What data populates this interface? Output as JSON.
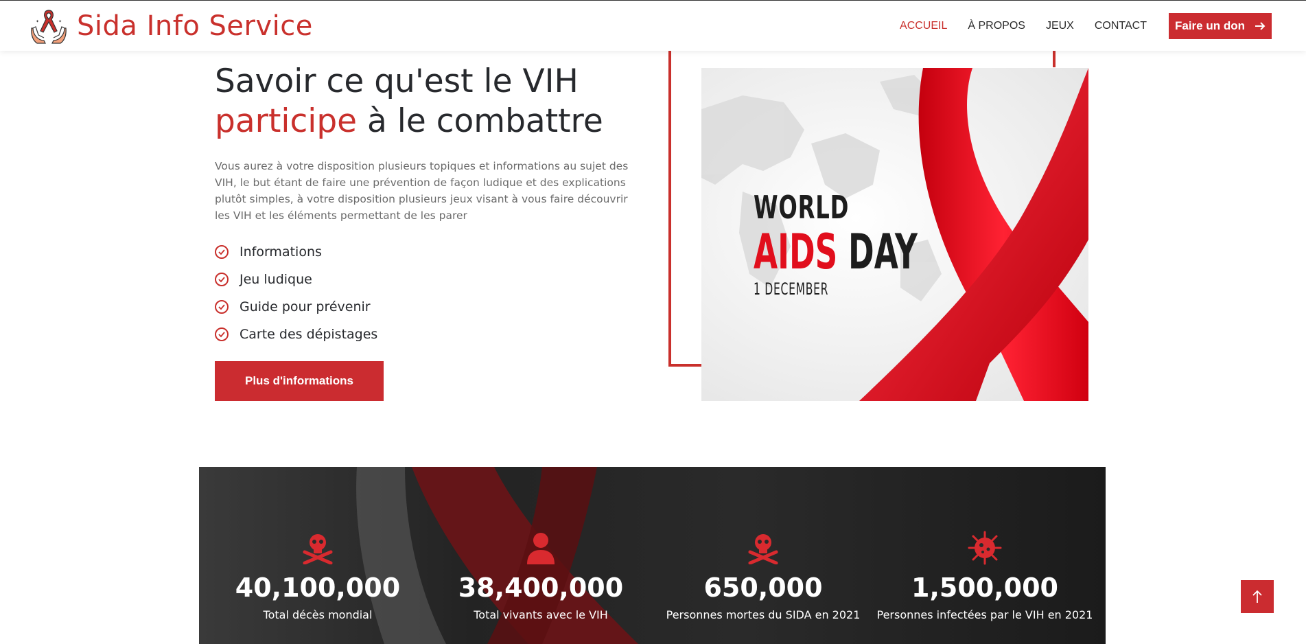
{
  "header": {
    "brand": "Sida Info Service",
    "nav": [
      {
        "label": "ACCUEIL",
        "active": true
      },
      {
        "label": "À PROPOS",
        "active": false
      },
      {
        "label": "JEUX",
        "active": false
      },
      {
        "label": "CONTACT",
        "active": false
      }
    ],
    "donate_label": "Faire un don"
  },
  "hero": {
    "title_line1": "Savoir ce qu'est le VIH",
    "title_accent": "participe",
    "title_rest": " à le combattre",
    "description": "Vous aurez à votre disposition plusieurs topiques et informations au sujet des VIH, le but étant de faire une prévention de façon ludique et des explications plutôt simples, à votre disposition plusieurs jeux visant à vous faire découvrir les VIH et les éléments permettant de les parer",
    "features": [
      "Informations",
      "Jeu ludique",
      "Guide pour prévenir",
      "Carte des dépistages"
    ],
    "button_label": "Plus d'informations"
  },
  "image": {
    "world": "WORLD",
    "aids": "AIDS",
    "day": "DAY",
    "date": "1 DECEMBER"
  },
  "stats": [
    {
      "icon": "skull-crossbones-icon",
      "value": "40,100,000",
      "label": "Total décès mondial"
    },
    {
      "icon": "person-icon",
      "value": "38,400,000",
      "label": "Total vivants avec le VIH"
    },
    {
      "icon": "skull-crossbones-icon",
      "value": "650,000",
      "label": "Personnes mortes du SIDA en 2021"
    },
    {
      "icon": "virus-icon",
      "value": "1,500,000",
      "label": "Personnes infectées par le VIH en 2021"
    }
  ],
  "colors": {
    "accent": "#c9302c",
    "text_dark": "#27292d",
    "text_muted": "#6b6b6b"
  }
}
